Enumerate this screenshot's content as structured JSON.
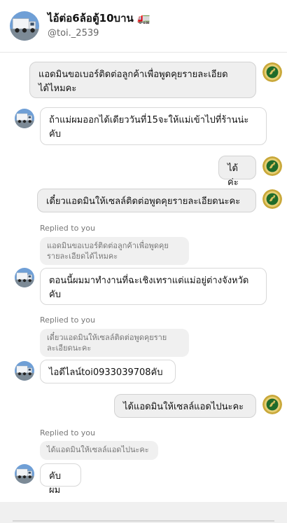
{
  "header": {
    "title": "ไอ้ต่อ6ล้อตู้10บาน",
    "title_emoji": "🚛",
    "handle": "@toi._2539"
  },
  "messages": [
    {
      "text_lines": [
        "แอดมินขอเบอร์ติดต่อลูกค้าเพื่อพูดคุยรายละเอียด",
        "ได้ไหมคะ"
      ]
    },
    {
      "text_lines": [
        "ถ้าแม่ผมออกได้เดียววันที่15จะให้แม่เข้าไปที่ร้านน่ะ",
        "คับ"
      ]
    },
    {
      "text_lines": [
        "ได้ค่ะ"
      ]
    },
    {
      "text_lines": [
        "เดี๋ยวแอดมินให้เซลล์ติดต่อพูดคุยรายละเอียดนะคะ"
      ]
    },
    {
      "replied_label": "Replied to you",
      "quote_lines": [
        "แอดมินขอเบอร์ติดต่อลูกค้าเพื่อพูดคุย",
        "รายละเอียดได้ไหมคะ"
      ],
      "text_lines": [
        "ตอนนี้ผมมาทำงานที่ฉะเชิงเทราแต่แม่อยู่ต่างจังหวัด",
        "คับ"
      ]
    },
    {
      "replied_label": "Replied to you",
      "quote_lines": [
        "เดี๋ยวแอดมินให้เซลล์ติดต่อพูดคุยราย",
        "ละเอียดนะคะ"
      ],
      "text_lines": [
        "ไอดีไลน์toi0933039708คับ"
      ]
    },
    {
      "text_lines": [
        "ได้แอดมินให้เซลล์แอดไปนะคะ"
      ]
    },
    {
      "replied_label": "Replied to you",
      "quote_lines": [
        "ได้แอดมินให้เซลล์แอดไปนะคะ"
      ],
      "text_lines": [
        "คับผม"
      ]
    }
  ],
  "colors": {
    "outgoing_bubble": "#efefef",
    "incoming_bubble": "#ffffff",
    "admin_avatar_bg": "#c9a83a",
    "admin_avatar_center": "#1f6b2a",
    "user_avatar_bg": "#4a7fc0"
  },
  "icons": {
    "user_avatar": "truck-avatar",
    "admin_avatar": "emblem-avatar"
  }
}
